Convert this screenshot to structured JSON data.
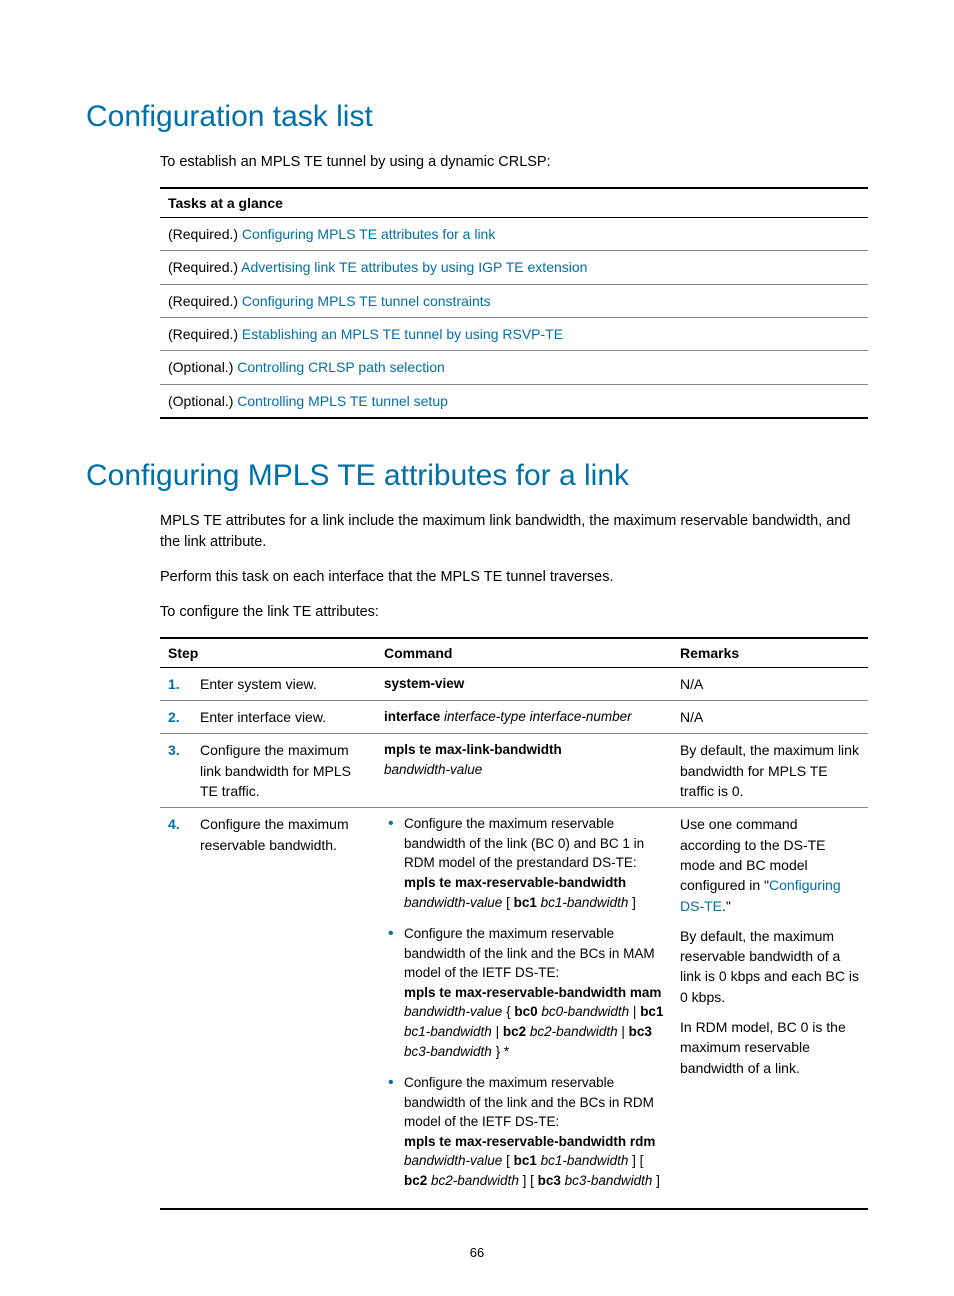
{
  "headings": {
    "h1a": "Configuration task list",
    "h1b": "Configuring MPLS TE attributes for a link"
  },
  "paragraphs": {
    "p1": "To establish an MPLS TE tunnel by using a dynamic CRLSP:",
    "p2": "MPLS TE attributes for a link include the maximum link bandwidth, the maximum reservable bandwidth, and the link attribute.",
    "p3": "Perform this task on each interface that the MPLS TE tunnel traverses.",
    "p4": "To configure the link TE attributes:"
  },
  "tasks_table": {
    "header": "Tasks at a glance",
    "rows": [
      {
        "prefix": "(Required.) ",
        "link": "Configuring MPLS TE attributes for a link"
      },
      {
        "prefix": "(Required.) ",
        "link": "Advertising link TE attributes by using IGP TE extension"
      },
      {
        "prefix": "(Required.) ",
        "link": "Configuring MPLS TE tunnel constraints"
      },
      {
        "prefix": "(Required.) ",
        "link": "Establishing an MPLS TE tunnel by using RSVP-TE"
      },
      {
        "prefix": "(Optional.) ",
        "link": "Controlling CRLSP path selection"
      },
      {
        "prefix": "(Optional.) ",
        "link": "Controlling MPLS TE tunnel setup"
      }
    ]
  },
  "step_table": {
    "headers": {
      "step": "Step",
      "command": "Command",
      "remarks": "Remarks"
    },
    "rows": {
      "r1": {
        "num": "1.",
        "desc": "Enter system view.",
        "cmd_bold": "system-view",
        "remarks": "N/A"
      },
      "r2": {
        "num": "2.",
        "desc": "Enter interface view.",
        "cmd_bold": "interface",
        "cmd_ital": " interface-type interface-number",
        "remarks": "N/A"
      },
      "r3": {
        "num": "3.",
        "desc": "Configure the maximum link bandwidth for MPLS TE traffic.",
        "cmd_bold": "mpls te max-link-bandwidth",
        "cmd_ital": "bandwidth-value",
        "remarks": "By default, the maximum link bandwidth for MPLS TE traffic is 0."
      },
      "r4": {
        "num": "4.",
        "desc": "Configure the maximum reservable bandwidth.",
        "bullets": {
          "b1": {
            "intro": "Configure the maximum reservable bandwidth of the link (BC 0) and BC 1 in RDM model of the prestandard DS-TE:",
            "cmd_b1": "mpls te max-reservable-bandwidth",
            "cmd_i1": "bandwidth-value",
            "cmd_after1": " [ ",
            "cmd_b2": "bc1",
            "cmd_i2": " bc1-bandwidth",
            "cmd_after2": " ]"
          },
          "b2": {
            "intro": "Configure the maximum reservable bandwidth of the link and the BCs in MAM model of the IETF DS-TE:",
            "line1_b": "mpls te max-reservable-bandwidth mam",
            "line1_i": " bandwidth-value",
            "line1_a": " { ",
            "bc0b": "bc0",
            "bc0i": " bc0-bandwidth",
            "sep1": " | ",
            "bc1b": "bc1",
            "bc1i": " bc1-bandwidth",
            "sep2": " | ",
            "bc2b": "bc2",
            "bc2i": " bc2-bandwidth",
            "sep3": " | ",
            "bc3b": "bc3",
            "bc3i": " bc3-bandwidth",
            "end": " } *"
          },
          "b3": {
            "intro": "Configure the maximum reservable bandwidth of the link and the BCs in RDM model of the IETF DS-TE:",
            "cmd_b": "mpls te max-reservable-bandwidth rdm",
            "cmd_i": " bandwidth-value",
            "a1": " [ ",
            "bc1b": "bc1",
            "bc1i": " bc1-bandwidth",
            "a2": " ] [ ",
            "bc2b": "bc2",
            "bc2i": " bc2-bandwidth",
            "a3": " ] [ ",
            "bc3b": "bc3",
            "bc3i": " bc3-bandwidth",
            "a4": " ]"
          }
        },
        "remarks": {
          "p1a": "Use one command according to the DS-TE mode and BC model configured in \"",
          "link": "Configuring DS-TE",
          "p1b": ".\"",
          "p2": "By default, the maximum reservable bandwidth of a link is 0 kbps and each BC is 0 kbps.",
          "p3": "In RDM model, BC 0 is the maximum reservable bandwidth of a link."
        }
      }
    }
  },
  "footer": {
    "page": "66"
  }
}
